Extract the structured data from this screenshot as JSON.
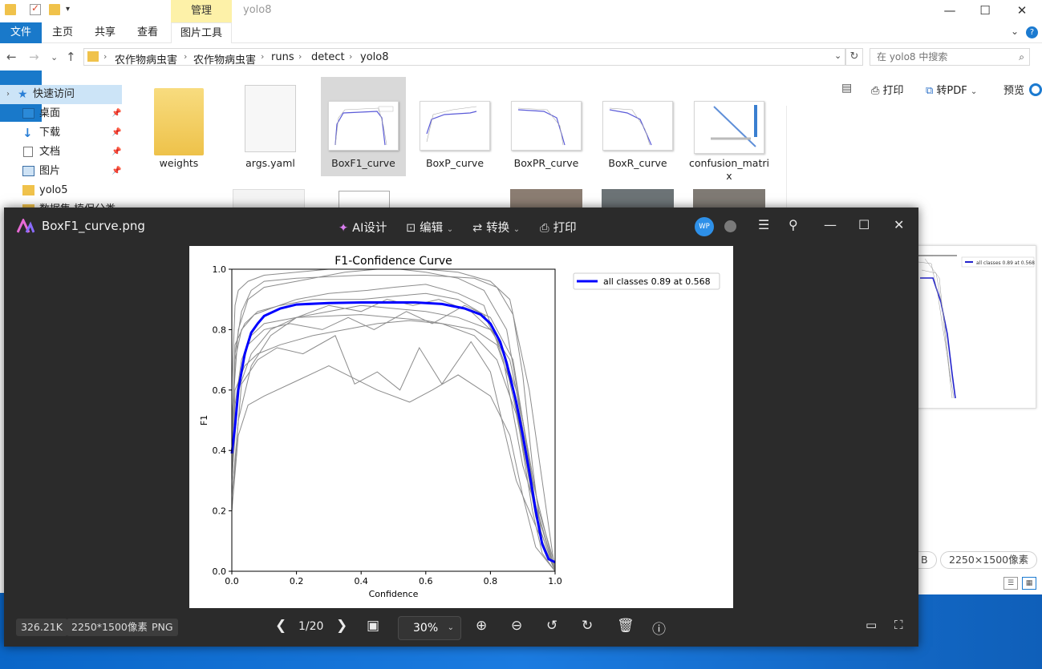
{
  "explorer": {
    "window_title": "yolo8",
    "manage_tab": "管理",
    "ribbon_tabs": [
      "文件",
      "主页",
      "共享",
      "查看",
      "图片工具"
    ],
    "breadcrumb": [
      "农作物病虫害",
      "农作物病虫害",
      "runs",
      "detect",
      "yolo8"
    ],
    "search_placeholder": "在 yolo8 中搜索",
    "sidebar": [
      {
        "label": "快速访问",
        "icon": "star-icon"
      },
      {
        "label": "桌面",
        "icon": "desktop-icon"
      },
      {
        "label": "下载",
        "icon": "download-icon"
      },
      {
        "label": "文档",
        "icon": "document-icon"
      },
      {
        "label": "图片",
        "icon": "picture-icon"
      },
      {
        "label": "yolo5",
        "icon": "folder-icon"
      },
      {
        "label": "数据集 植保分类",
        "icon": "folder-icon"
      }
    ],
    "files": [
      {
        "name": "weights",
        "type": "folder"
      },
      {
        "name": "args.yaml",
        "type": "file"
      },
      {
        "name": "BoxF1_curve",
        "type": "image",
        "selected": true
      },
      {
        "name": "BoxP_curve",
        "type": "image"
      },
      {
        "name": "BoxPR_curve",
        "type": "image"
      },
      {
        "name": "BoxR_curve",
        "type": "image"
      },
      {
        "name": "confusion_matri\nx",
        "type": "image"
      }
    ],
    "commands": {
      "print": "打印",
      "to_pdf": "转PDF",
      "preview": "预览"
    },
    "preview_size_chip": "2250×1500像素",
    "preview_size_partial": "B"
  },
  "viewer": {
    "file_name": "BoxF1_curve.png",
    "tools": {
      "ai": "AI设计",
      "edit": "编辑",
      "convert": "转换",
      "print": "打印"
    },
    "avatar": "WP",
    "file_size": "326.21K",
    "dimensions": "2250*1500像素",
    "format": "PNG",
    "page": "1/20",
    "zoom": "30%"
  },
  "chart_data": {
    "type": "line",
    "title": "F1-Confidence Curve",
    "xlabel": "Confidence",
    "ylabel": "F1",
    "xlim": [
      0.0,
      1.0
    ],
    "ylim": [
      0.0,
      1.0
    ],
    "xticks": [
      "0.0",
      "0.2",
      "0.4",
      "0.6",
      "0.8",
      "1.0"
    ],
    "yticks": [
      "0.0",
      "0.2",
      "0.4",
      "0.6",
      "0.8",
      "1.0"
    ],
    "legend_position": "outside-right",
    "series": [
      {
        "name": "all classes 0.89 at 0.568",
        "color": "#0000ff",
        "x": [
          0.0,
          0.01,
          0.02,
          0.04,
          0.06,
          0.08,
          0.1,
          0.15,
          0.2,
          0.3,
          0.4,
          0.5,
          0.568,
          0.65,
          0.72,
          0.77,
          0.8,
          0.83,
          0.85,
          0.88,
          0.9,
          0.92,
          0.94,
          0.96,
          0.98,
          1.0
        ],
        "y": [
          0.39,
          0.48,
          0.6,
          0.72,
          0.79,
          0.82,
          0.845,
          0.87,
          0.883,
          0.888,
          0.89,
          0.89,
          0.89,
          0.885,
          0.87,
          0.85,
          0.82,
          0.76,
          0.69,
          0.56,
          0.45,
          0.33,
          0.2,
          0.09,
          0.04,
          0.03
        ]
      }
    ],
    "background_series": [
      {
        "x": [
          0.0,
          0.01,
          0.03,
          0.06,
          0.1,
          0.2,
          0.4,
          0.6,
          0.75,
          0.82,
          0.87,
          0.9,
          0.93,
          0.96,
          1.0
        ],
        "y": [
          0.4,
          0.72,
          0.86,
          0.93,
          0.96,
          0.97,
          0.98,
          0.98,
          0.97,
          0.94,
          0.85,
          0.65,
          0.35,
          0.1,
          0.0
        ]
      },
      {
        "x": [
          0.0,
          0.01,
          0.03,
          0.06,
          0.1,
          0.2,
          0.4,
          0.6,
          0.75,
          0.82,
          0.87,
          0.9,
          0.93,
          0.96,
          1.0
        ],
        "y": [
          0.3,
          0.55,
          0.7,
          0.78,
          0.82,
          0.84,
          0.85,
          0.83,
          0.8,
          0.75,
          0.6,
          0.4,
          0.2,
          0.06,
          0.0
        ]
      },
      {
        "x": [
          0.0,
          0.02,
          0.05,
          0.1,
          0.2,
          0.3,
          0.45,
          0.55,
          0.62,
          0.7,
          0.8,
          0.86,
          0.9,
          0.94,
          1.0
        ],
        "y": [
          0.2,
          0.45,
          0.55,
          0.58,
          0.63,
          0.68,
          0.6,
          0.56,
          0.6,
          0.65,
          0.58,
          0.45,
          0.25,
          0.08,
          0.0
        ]
      },
      {
        "x": [
          0.0,
          0.02,
          0.05,
          0.1,
          0.2,
          0.35,
          0.45,
          0.52,
          0.6,
          0.7,
          0.78,
          0.85,
          0.9,
          0.95,
          1.0
        ],
        "y": [
          0.5,
          0.8,
          0.9,
          0.94,
          0.96,
          0.99,
          1.0,
          1.0,
          0.99,
          0.97,
          0.93,
          0.8,
          0.5,
          0.15,
          0.0
        ]
      },
      {
        "x": [
          0.0,
          0.01,
          0.04,
          0.08,
          0.15,
          0.25,
          0.35,
          0.45,
          0.55,
          0.65,
          0.75,
          0.82,
          0.88,
          0.93,
          1.0
        ],
        "y": [
          0.3,
          0.6,
          0.68,
          0.72,
          0.75,
          0.78,
          0.8,
          0.82,
          0.83,
          0.82,
          0.78,
          0.7,
          0.52,
          0.25,
          0.0
        ]
      },
      {
        "x": [
          0.0,
          0.01,
          0.03,
          0.07,
          0.12,
          0.2,
          0.3,
          0.42,
          0.5,
          0.6,
          0.7,
          0.78,
          0.84,
          0.9,
          1.0
        ],
        "y": [
          0.35,
          0.7,
          0.8,
          0.85,
          0.87,
          0.9,
          0.92,
          0.93,
          0.94,
          0.95,
          0.92,
          0.88,
          0.7,
          0.35,
          0.0
        ]
      },
      {
        "x": [
          0.0,
          0.03,
          0.08,
          0.14,
          0.22,
          0.32,
          0.38,
          0.45,
          0.52,
          0.58,
          0.65,
          0.74,
          0.8,
          0.88,
          1.0
        ],
        "y": [
          0.25,
          0.62,
          0.7,
          0.74,
          0.72,
          0.78,
          0.62,
          0.66,
          0.6,
          0.74,
          0.62,
          0.76,
          0.66,
          0.3,
          0.0
        ]
      },
      {
        "x": [
          0.0,
          0.01,
          0.02,
          0.05,
          0.1,
          0.2,
          0.3,
          0.4,
          0.5,
          0.6,
          0.7,
          0.8,
          0.86,
          0.92,
          1.0
        ],
        "y": [
          0.6,
          0.88,
          0.93,
          0.96,
          0.98,
          0.99,
          1.0,
          1.0,
          1.0,
          1.0,
          0.99,
          0.96,
          0.9,
          0.6,
          0.0
        ]
      },
      {
        "x": [
          0.0,
          0.02,
          0.06,
          0.12,
          0.2,
          0.3,
          0.4,
          0.5,
          0.6,
          0.7,
          0.8,
          0.86,
          0.9,
          0.95,
          1.0
        ],
        "y": [
          0.3,
          0.6,
          0.72,
          0.8,
          0.84,
          0.86,
          0.88,
          0.87,
          0.86,
          0.84,
          0.8,
          0.7,
          0.5,
          0.2,
          0.02
        ]
      },
      {
        "x": [
          0.0,
          0.02,
          0.05,
          0.1,
          0.18,
          0.28,
          0.36,
          0.44,
          0.54,
          0.62,
          0.72,
          0.8,
          0.87,
          0.93,
          1.0
        ],
        "y": [
          0.3,
          0.62,
          0.75,
          0.8,
          0.82,
          0.8,
          0.84,
          0.8,
          0.86,
          0.82,
          0.88,
          0.84,
          0.7,
          0.3,
          0.0
        ]
      },
      {
        "x": [
          0.0,
          0.01,
          0.04,
          0.08,
          0.15,
          0.25,
          0.4,
          0.5,
          0.6,
          0.7,
          0.78,
          0.84,
          0.89,
          0.94,
          1.0
        ],
        "y": [
          0.45,
          0.75,
          0.82,
          0.86,
          0.88,
          0.9,
          0.9,
          0.91,
          0.92,
          0.9,
          0.85,
          0.72,
          0.48,
          0.18,
          0.0
        ]
      },
      {
        "x": [
          0.0,
          0.02,
          0.06,
          0.12,
          0.2,
          0.3,
          0.4,
          0.48,
          0.56,
          0.64,
          0.74,
          0.82,
          0.88,
          0.94,
          1.0
        ],
        "y": [
          0.2,
          0.5,
          0.68,
          0.78,
          0.84,
          0.88,
          0.86,
          0.9,
          0.88,
          0.9,
          0.86,
          0.78,
          0.6,
          0.22,
          0.0
        ]
      }
    ]
  }
}
